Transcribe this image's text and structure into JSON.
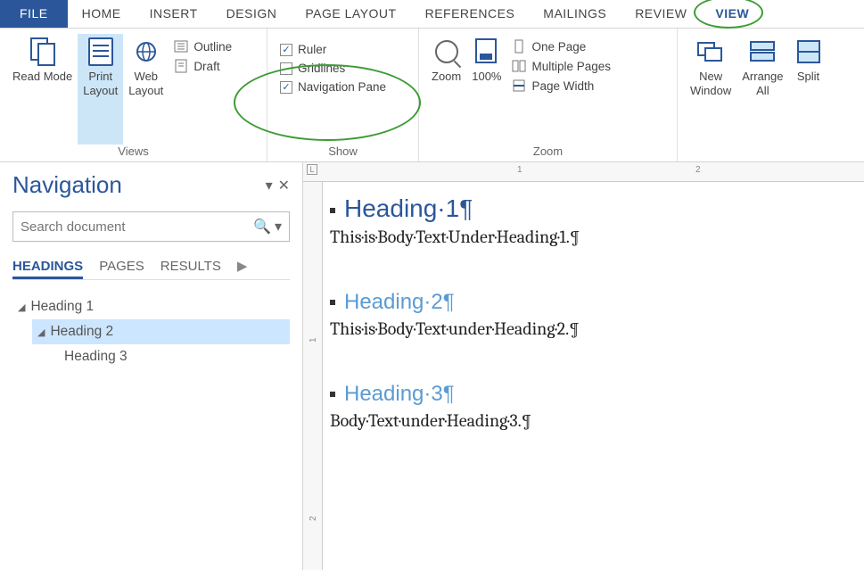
{
  "tabs": {
    "file": "FILE",
    "home": "HOME",
    "insert": "INSERT",
    "design": "DESIGN",
    "page_layout": "PAGE LAYOUT",
    "references": "REFERENCES",
    "mailings": "MAILINGS",
    "review": "REVIEW",
    "view": "VIEW"
  },
  "ribbon": {
    "views": {
      "read_mode": "Read Mode",
      "print_layout": "Print Layout",
      "web_layout": "Web Layout",
      "outline": "Outline",
      "draft": "Draft",
      "group_label": "Views"
    },
    "show": {
      "ruler": "Ruler",
      "gridlines": "Gridlines",
      "nav_pane": "Navigation Pane",
      "group_label": "Show"
    },
    "zoom": {
      "zoom": "Zoom",
      "hundred": "100%",
      "one_page": "One Page",
      "multiple_pages": "Multiple Pages",
      "page_width": "Page Width",
      "group_label": "Zoom"
    },
    "window": {
      "new_window": "New Window",
      "arrange_all": "Arrange All",
      "split": "Split"
    }
  },
  "nav": {
    "title": "Navigation",
    "search_placeholder": "Search document",
    "tabs": {
      "headings": "HEADINGS",
      "pages": "PAGES",
      "results": "RESULTS"
    },
    "tree": {
      "h1": "Heading 1",
      "h2": "Heading 2",
      "h3": "Heading 3"
    }
  },
  "ruler": {
    "one": "1",
    "two": "2",
    "v_one": "1",
    "v_two": "2"
  },
  "doc": {
    "h1": "Heading·1¶",
    "b1": "This·is·Body·Text·Under·Heading·1.¶",
    "h2": "Heading·2¶",
    "b2": "This·is·Body·Text·under·Heading·2.¶",
    "h3": "Heading·3¶",
    "b3": "Body·Text·under·Heading·3.¶"
  }
}
